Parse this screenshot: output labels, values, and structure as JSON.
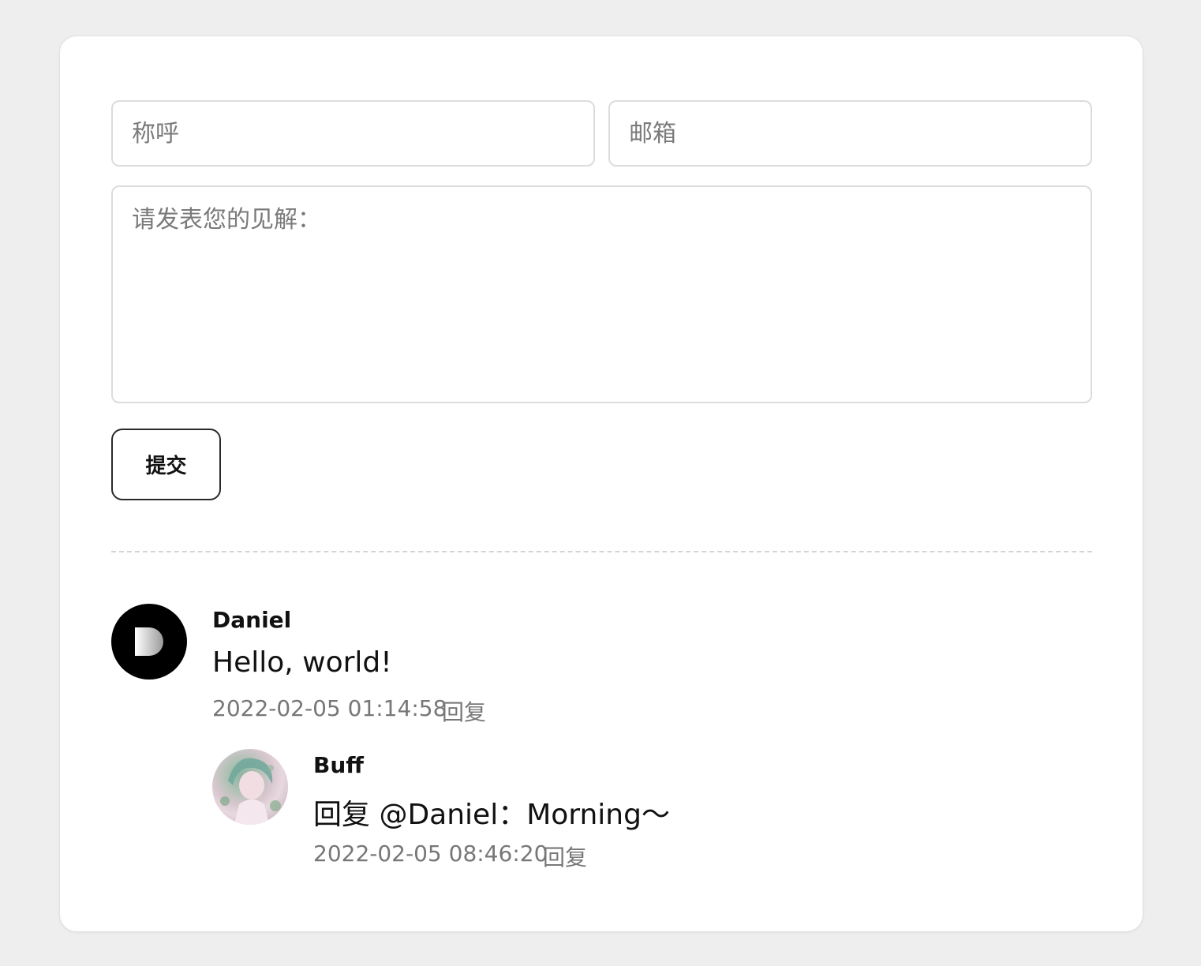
{
  "form": {
    "name_placeholder": "称呼",
    "email_placeholder": "邮箱",
    "comment_placeholder": "请发表您的见解：",
    "submit_label": "提交"
  },
  "comments": [
    {
      "author": "Daniel",
      "avatar_letter": "D",
      "content": "Hello, world!",
      "timestamp": "2022-02-05 01:14:58",
      "reply_label": "回复",
      "replies": [
        {
          "author": "Buff",
          "content": "回复 @Daniel：Morning～",
          "timestamp": "2022-02-05 08:46:20",
          "reply_label": "回复"
        }
      ]
    }
  ],
  "colors": {
    "page_background": "#eeeeee",
    "card_background": "#ffffff",
    "placeholder_text": "#7a7a7a",
    "meta_text": "#777777"
  }
}
